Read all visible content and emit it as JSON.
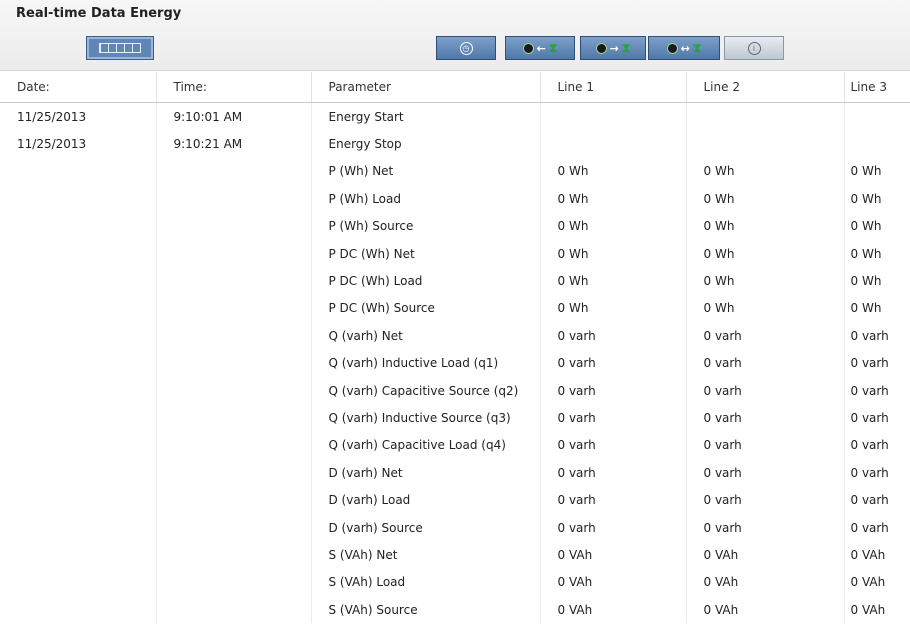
{
  "panel": {
    "title": "Real-time Data Energy"
  },
  "toolbar": {
    "view_icon": "grid-view-icon",
    "buttons": [
      {
        "name": "clock-icon",
        "label": "◷"
      },
      {
        "name": "import-icon",
        "label": "←"
      },
      {
        "name": "export-icon",
        "label": "→"
      },
      {
        "name": "bidirectional-icon",
        "label": "↔"
      },
      {
        "name": "info-icon",
        "label": "i"
      }
    ]
  },
  "table": {
    "columns": [
      "Date:",
      "Time:",
      "Parameter",
      "Line 1",
      "Line 2",
      "Line 3"
    ],
    "rows": [
      [
        "11/25/2013",
        "9:10:01 AM",
        "Energy Start",
        "",
        "",
        ""
      ],
      [
        "11/25/2013",
        "9:10:21 AM",
        "Energy Stop",
        "",
        "",
        ""
      ],
      [
        "",
        "",
        "P (Wh) Net",
        "0 Wh",
        "0 Wh",
        "0 Wh"
      ],
      [
        "",
        "",
        "P (Wh) Load",
        "0 Wh",
        "0 Wh",
        "0 Wh"
      ],
      [
        "",
        "",
        "P (Wh) Source",
        "0 Wh",
        "0 Wh",
        "0 Wh"
      ],
      [
        "",
        "",
        "P DC (Wh) Net",
        "0 Wh",
        "0 Wh",
        "0 Wh"
      ],
      [
        "",
        "",
        "P DC (Wh) Load",
        "0 Wh",
        "0 Wh",
        "0 Wh"
      ],
      [
        "",
        "",
        "P DC (Wh) Source",
        "0 Wh",
        "0 Wh",
        "0 Wh"
      ],
      [
        "",
        "",
        "Q (varh) Net",
        "0 varh",
        "0 varh",
        "0 varh"
      ],
      [
        "",
        "",
        "Q (varh) Inductive Load (q1)",
        "0 varh",
        "0 varh",
        "0 varh"
      ],
      [
        "",
        "",
        "Q (varh) Capacitive Source (q2)",
        "0 varh",
        "0 varh",
        "0 varh"
      ],
      [
        "",
        "",
        "Q (varh) Inductive Source (q3)",
        "0 varh",
        "0 varh",
        "0 varh"
      ],
      [
        "",
        "",
        "Q (varh) Capacitive Load (q4)",
        "0 varh",
        "0 varh",
        "0 varh"
      ],
      [
        "",
        "",
        "D (varh) Net",
        "0 varh",
        "0 varh",
        "0 varh"
      ],
      [
        "",
        "",
        "D (varh) Load",
        "0 varh",
        "0 varh",
        "0 varh"
      ],
      [
        "",
        "",
        "D (varh) Source",
        "0 varh",
        "0 varh",
        "0 varh"
      ],
      [
        "",
        "",
        "S (VAh) Net",
        "0 VAh",
        "0 VAh",
        "0 VAh"
      ],
      [
        "",
        "",
        "S (VAh) Load",
        "0 VAh",
        "0 VAh",
        "0 VAh"
      ],
      [
        "",
        "",
        "S (VAh) Source",
        "0 VAh",
        "0 VAh",
        "0 VAh"
      ]
    ]
  }
}
